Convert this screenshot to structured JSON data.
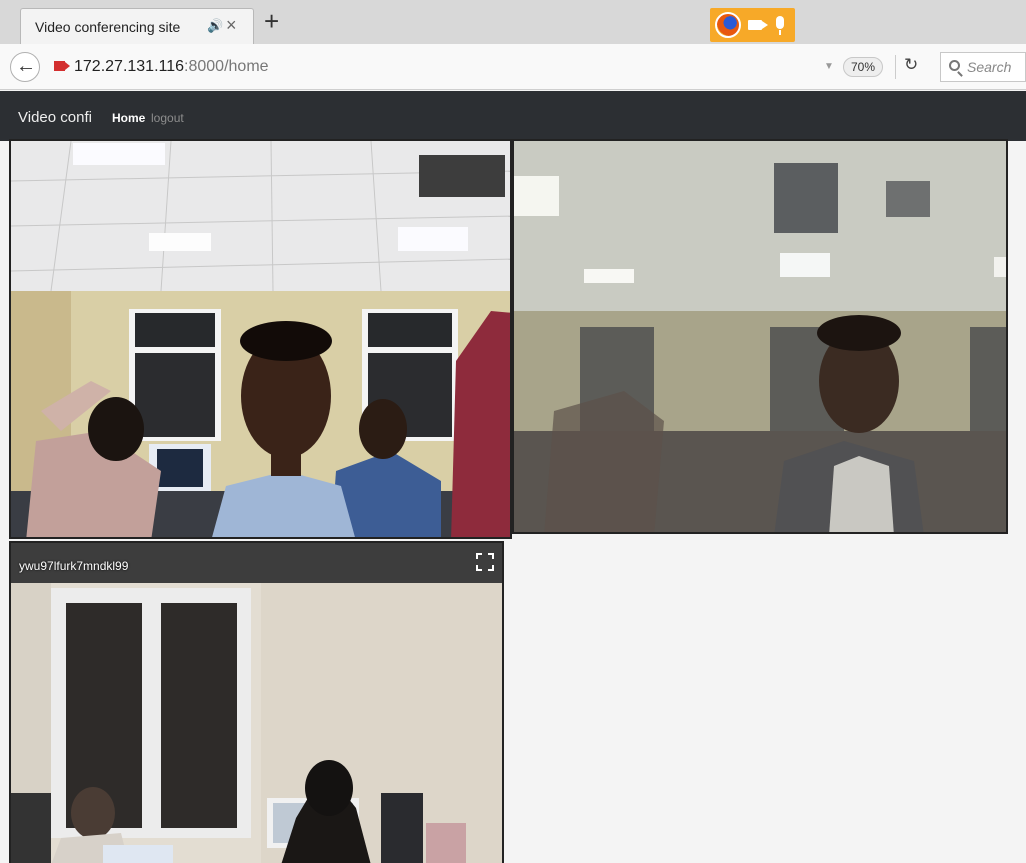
{
  "browser": {
    "tab_title": "Video conferencing site",
    "url_host": "172.27.131.116",
    "url_rest": ":8000/home",
    "zoom": "70%",
    "search_placeholder": "Search",
    "sharing_color": "#f7a928"
  },
  "site": {
    "brand": "Video confi",
    "nav_home": "Home",
    "nav_logout": "logout"
  },
  "videos": [
    {
      "label": ""
    },
    {
      "label": ""
    },
    {
      "label": "ywu97lfurk7mndkl99"
    }
  ],
  "icons": [
    "back-arrow-icon",
    "camera-icon",
    "microphone-icon",
    "speaker-icon",
    "close-icon",
    "plus-icon",
    "reload-icon",
    "search-icon",
    "fullscreen-icon",
    "firefox-icon"
  ]
}
